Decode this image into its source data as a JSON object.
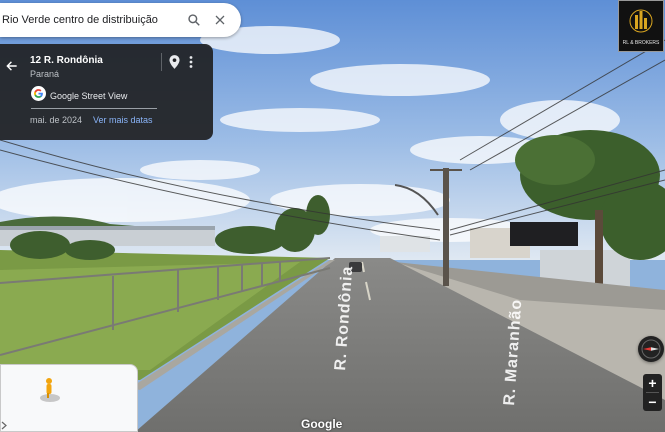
{
  "search": {
    "query": "Rio Verde centro de distribuição",
    "search_icon": "search-icon",
    "close_icon": "close-icon"
  },
  "info_card": {
    "back_icon": "arrow-back-icon",
    "title": "12 R. Rondônia",
    "subtitle": "Paraná",
    "pin_icon": "location-pin-icon",
    "more_icon": "more-vert-icon",
    "source_label": "Google Street View",
    "date": "mai. de 2024",
    "more_dates_link": "Ver mais datas"
  },
  "road_markings": {
    "left": "R. Rondônia",
    "right": "R. Maranhão"
  },
  "brand_logo": {
    "text": "RL & BROKERS"
  },
  "controls": {
    "zoom_in": "+",
    "zoom_out": "−",
    "compass_icon": "compass-icon"
  },
  "watermark": "Google",
  "colors": {
    "card_bg": "#202124",
    "link": "#8ab4f8",
    "sky": "#7fa8dd"
  }
}
